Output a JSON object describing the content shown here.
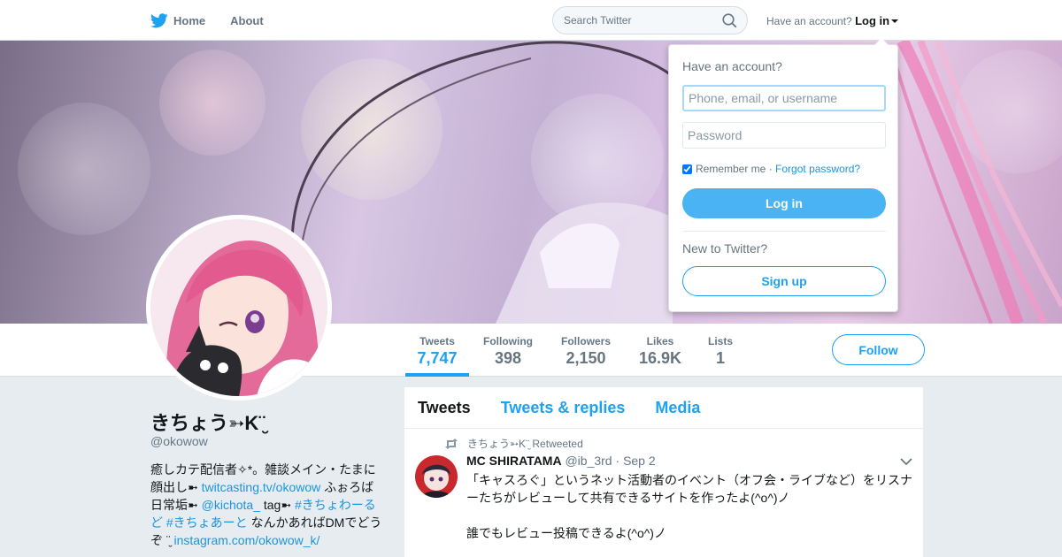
{
  "nav": {
    "home_label": "Home",
    "about_label": "About",
    "search_placeholder": "Search Twitter",
    "account_prompt": "Have an account?",
    "login_label": "Log in"
  },
  "profile": {
    "name": "きちょう➳K¨̮",
    "handle": "@okowow",
    "bio": {
      "line1": "癒しカテ配信者✧*。雑談メイン・たまに",
      "line2_prefix": "顔出し➼ ",
      "twitcasting_link": "twitcasting.tv/okowow",
      "line2_suffix": " ふぉろば",
      "line3_prefix": "日常垢➼ ",
      "mention": "@kichota_",
      "tag_text": " tag➼ ",
      "hashtag1": "#きちょわーるど",
      "hashtag2": "#きちょあーと",
      "line4_suffix": " なんかあればDMでどうぞ ¨̮ ",
      "instagram_link": "instagram.com/okowow_k/"
    }
  },
  "stats": [
    {
      "label": "Tweets",
      "value": "7,747",
      "active": true
    },
    {
      "label": "Following",
      "value": "398"
    },
    {
      "label": "Followers",
      "value": "2,150"
    },
    {
      "label": "Likes",
      "value": "16.9K"
    },
    {
      "label": "Lists",
      "value": "1"
    }
  ],
  "follow_label": "Follow",
  "timeline": {
    "tabs": [
      "Tweets",
      "Tweets & replies",
      "Media"
    ],
    "tweet": {
      "retweeted_by": "きちょう➳K¨̮ Retweeted",
      "author_name": "MC SHIRATAMA",
      "author_handle": "@ib_3rd",
      "separator": "·",
      "date": "Sep 2",
      "text": "「キャスろぐ」というネット活動者のイベント（オフ会・ライブなど）をリスナーたちがレビューして共有できるサイトを作ったよ(^o^)ノ",
      "text2": "誰でもレビュー投稿できるよ(^o^)ノ"
    }
  },
  "login_popup": {
    "title": "Have an account?",
    "username_placeholder": "Phone, email, or username",
    "password_placeholder": "Password",
    "remember_label": "Remember me",
    "separator": "·",
    "forgot_label": "Forgot password?",
    "login_button": "Log in",
    "new_prompt": "New to Twitter?",
    "signup_button": "Sign up",
    "remember_checked": true
  },
  "colors": {
    "brand": "#1da1f2",
    "link": "#1b95e0",
    "login_button": "#4ab3f4"
  }
}
